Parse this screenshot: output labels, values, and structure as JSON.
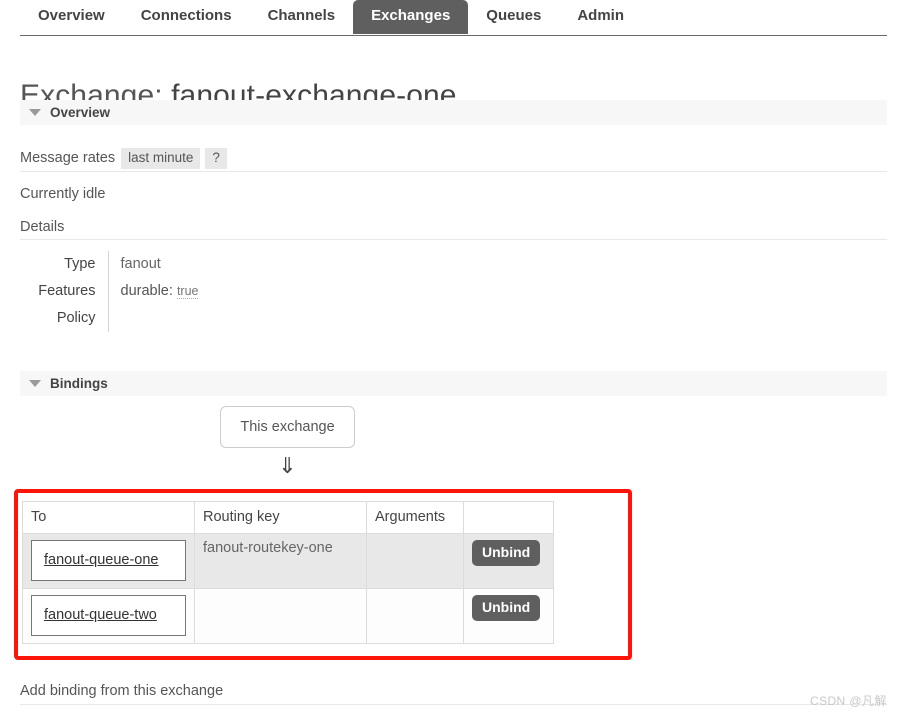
{
  "nav": {
    "tabs": [
      {
        "label": "Overview",
        "active": false
      },
      {
        "label": "Connections",
        "active": false
      },
      {
        "label": "Channels",
        "active": false
      },
      {
        "label": "Exchanges",
        "active": true
      },
      {
        "label": "Queues",
        "active": false
      },
      {
        "label": "Admin",
        "active": false
      }
    ],
    "active_tab": "Exchanges",
    "active_bg": "#605f5f"
  },
  "page": {
    "title_prefix": "Exchange:",
    "title_name": "fanout-exchange-one"
  },
  "overview": {
    "section_label": "Overview",
    "message_rates_label": "Message rates",
    "message_rates_period": "last minute",
    "help_label": "?",
    "status_text": "Currently idle",
    "details_label": "Details",
    "details_rows": [
      {
        "label": "Type",
        "value": "fanout"
      },
      {
        "label": "Features",
        "feature_name": "durable:",
        "feature_value": "true"
      },
      {
        "label": "Policy",
        "value": ""
      }
    ]
  },
  "bindings": {
    "section_label": "Bindings",
    "this_exchange_label": "This exchange",
    "arrow_glyph": "⇓",
    "columns": [
      "To",
      "Routing key",
      "Arguments",
      ""
    ],
    "rows": [
      {
        "to": "fanout-queue-one",
        "routing_key": "fanout-routekey-one",
        "arguments": "",
        "action_label": "Unbind"
      },
      {
        "to": "fanout-queue-two",
        "routing_key": "",
        "arguments": "",
        "action_label": "Unbind"
      }
    ],
    "highlight_color": "#fc1508",
    "add_binding_label": "Add binding from this exchange"
  },
  "watermark": {
    "text": "CSDN @凡解"
  }
}
